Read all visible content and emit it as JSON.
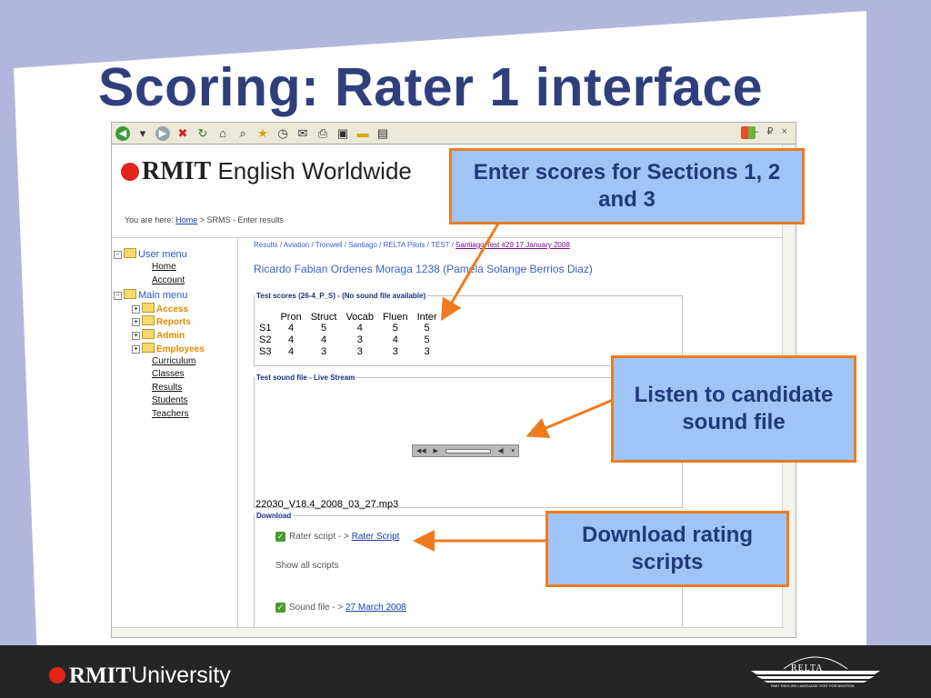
{
  "slide": {
    "title": "Scoring: Rater 1 interface"
  },
  "browser": {
    "window_controls": "– ₽ ×"
  },
  "site": {
    "logo_bold": "RMIT",
    "logo_rest": "English Worldwide",
    "crumb_prefix": "You are here:",
    "crumb_home": "Home",
    "crumb_rest": "> SRMS - Enter results"
  },
  "sidebar": {
    "user_menu": "User menu",
    "user_items": [
      "Home",
      "Account"
    ],
    "main_menu": "Main menu",
    "folders": [
      "Access",
      "Reports",
      "Admin",
      "Employees"
    ],
    "links": [
      "Curriculum",
      "Classes",
      "Results",
      "Students",
      "Teachers"
    ]
  },
  "content": {
    "breadcrumb": "Results / Aviation / Tronwell / Santiago / RELTA Pilots / TEST /",
    "breadcrumb_current": "Santiago Test #29 17 January 2008",
    "candidate": "Ricardo Fabian Ordenes Moraga 1238 (Pamela Solange Berrios Diaz)",
    "scores_legend": "Test scores (26-4_P_S) - (No sound file available)",
    "score_headers": [
      "",
      "Pron",
      "Struct",
      "Vocab",
      "Fluen",
      "Inter"
    ],
    "score_rows": [
      [
        "S1",
        "4",
        "5",
        "4",
        "5",
        "5"
      ],
      [
        "S2",
        "4",
        "4",
        "3",
        "4",
        "5"
      ],
      [
        "S3",
        "4",
        "3",
        "3",
        "3",
        "3"
      ]
    ],
    "sound_legend": "Test sound file - Live Stream",
    "sound_filename": "22030_V18.4_2008_03_27.mp3",
    "download_legend": "Download",
    "rater_script_label": "Rater script - >",
    "rater_script_link": "Rater Script",
    "show_all": "Show all scripts",
    "sound_file_label": "Sound file - >",
    "sound_file_link": "27 March 2008"
  },
  "callouts": {
    "enter_scores": "Enter scores for Sections 1, 2 and 3",
    "listen": "Listen to candidate sound file",
    "download": "Download rating scripts"
  },
  "footer": {
    "university_bold": "RMIT",
    "university_rest": "University",
    "relta": "RELTA",
    "relta_sub": "RMIT ENGLISH LANGUAGE TEST FOR AVIATION"
  },
  "colors": {
    "title": "#2f3f7c",
    "callout_fill": "#9fc5f8",
    "callout_border": "#f07b1f",
    "arrow": "#f07b1f",
    "background": "#b3b6dc",
    "footer": "#252525"
  }
}
